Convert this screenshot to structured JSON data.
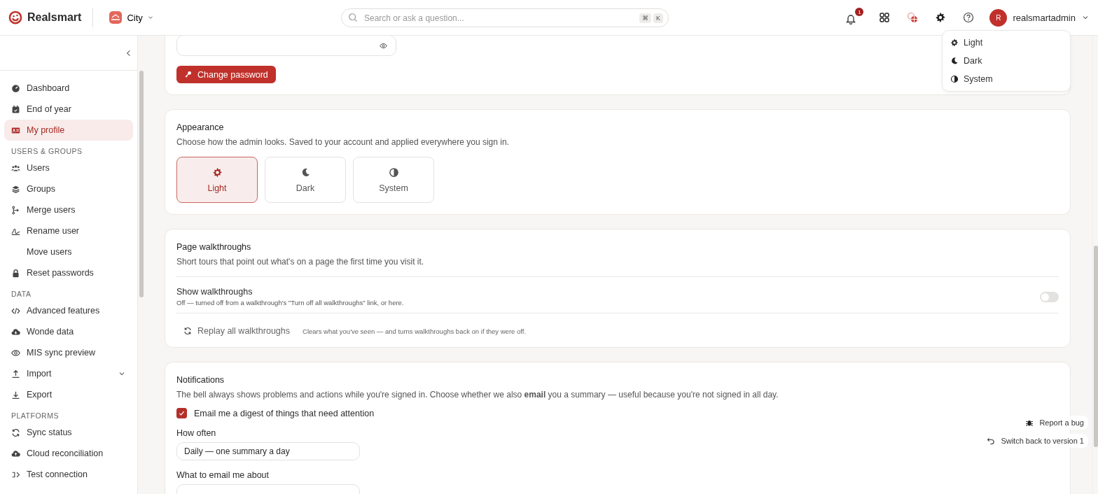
{
  "header": {
    "brand": "Realsmart",
    "school": {
      "name": "City"
    },
    "search": {
      "placeholder": "Search or ask a question...",
      "keys": [
        "⌘",
        "K"
      ]
    },
    "notifications": {
      "count": "1"
    },
    "user": {
      "initial": "R",
      "name": "realsmartadmin"
    }
  },
  "theme_menu": {
    "items": [
      {
        "label": "Light"
      },
      {
        "label": "Dark"
      },
      {
        "label": "System"
      }
    ]
  },
  "sidebar": {
    "sections": [
      {
        "items": [
          {
            "label": "Dashboard",
            "selected": false
          },
          {
            "label": "End of year",
            "selected": false
          },
          {
            "label": "My profile",
            "selected": true
          }
        ]
      },
      {
        "heading": "USERS & GROUPS",
        "items": [
          {
            "label": "Users",
            "selected": false
          },
          {
            "label": "Groups",
            "selected": false
          },
          {
            "label": "Merge users",
            "selected": false
          },
          {
            "label": "Rename user",
            "selected": false
          },
          {
            "label": "Move users",
            "selected": false
          },
          {
            "label": "Reset passwords",
            "selected": false
          }
        ]
      },
      {
        "heading": "DATA",
        "items": [
          {
            "label": "Advanced features",
            "selected": false
          },
          {
            "label": "Wonde data",
            "selected": false
          },
          {
            "label": "MIS sync preview",
            "selected": false
          },
          {
            "label": "Import",
            "selected": false,
            "expanded": false
          },
          {
            "label": "Export",
            "selected": false
          }
        ]
      },
      {
        "heading": "PLATFORMS",
        "items": [
          {
            "label": "Sync status",
            "selected": false
          },
          {
            "label": "Cloud reconciliation",
            "selected": false
          },
          {
            "label": "Test connection",
            "selected": false
          }
        ]
      }
    ]
  },
  "password": {
    "button": "Change password"
  },
  "appearance": {
    "title": "Appearance",
    "description": "Choose how the admin looks. Saved to your account and applied everywhere you sign in.",
    "options": [
      {
        "label": "Light",
        "selected": true
      },
      {
        "label": "Dark",
        "selected": false
      },
      {
        "label": "System",
        "selected": false
      }
    ]
  },
  "walkthroughs": {
    "title": "Page walkthroughs",
    "description": "Short tours that point out what's on a page the first time you visit it.",
    "setting": {
      "label": "Show walkthroughs",
      "hint": "Off — turned off from a walkthrough's \"Turn off all walkthroughs\" link, or here.",
      "on": false
    },
    "replay": {
      "label": "Replay all walkthroughs",
      "note": "Clears what you've seen — and turns walkthroughs back on if they were off."
    }
  },
  "notifications": {
    "title": "Notifications",
    "description": "The bell always shows problems and actions while you're signed in. Choose whether we also **email** you a summary — useful because you're not signed in all day.",
    "digest": {
      "label": "Email me a digest of things that need attention",
      "checked": true
    },
    "frequency": {
      "label": "How often",
      "value": "Daily — one summary a day"
    },
    "topics": {
      "label": "What to email me about"
    }
  },
  "floating": [
    {
      "label": "Report a bug"
    },
    {
      "label": "Switch back to version 1"
    }
  ]
}
